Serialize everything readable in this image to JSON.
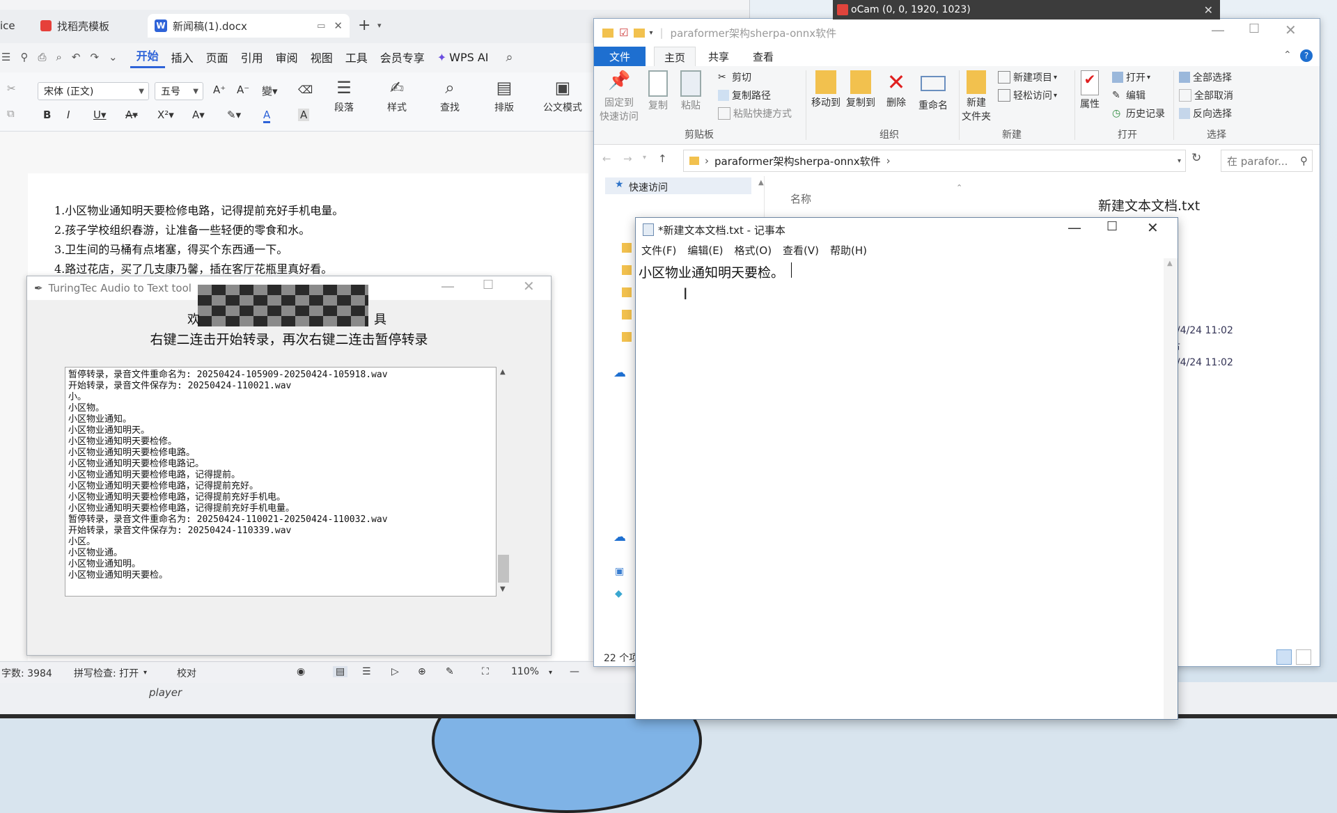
{
  "ocam": {
    "title": "oCam (0, 0, 1920, 1023)"
  },
  "desktop": {
    "player_label": "player"
  },
  "wps": {
    "tabs": [
      {
        "label": "ice"
      },
      {
        "label": "找稻壳模板"
      },
      {
        "label": "新闻稿(1).docx"
      }
    ],
    "menu": [
      "开始",
      "插入",
      "页面",
      "引用",
      "审阅",
      "视图",
      "工具",
      "会员专享"
    ],
    "wps_ai": "WPS AI",
    "font_name": "宋体 (正文)",
    "font_size": "五号",
    "ribbon_big": [
      "段落",
      "样式",
      "查找",
      "排版",
      "公文模式"
    ],
    "doc_lines": [
      "1.小区物业通知明天要检修电路，记得提前充好手机电量。",
      "2.孩子学校组织春游，让准备一些轻便的零食和水。",
      "3.卫生间的马桶有点堵塞，得买个东西通一下。",
      "4.路过花店，买了几支康乃馨，插在客厅花瓶里真好看。"
    ],
    "status": {
      "word_count": "字数: 3984",
      "spell_check": "拼写检查: 打开",
      "proofread": "校对",
      "zoom": "110%"
    }
  },
  "turingtec": {
    "title": "TuringTec Audio to Text tool",
    "line1": "欢",
    "line1_end": "具",
    "line2": "右键二连击开始转录，再次右键二连击暂停转录",
    "log": [
      "暂停转录，录音文件重命名为: 20250424-105909-20250424-105918.wav",
      "开始转录，录音文件保存为: 20250424-110021.wav",
      "小。",
      "小区物。",
      "小区物业通知。",
      "小区物业通知明天。",
      "小区物业通知明天要检修。",
      "小区物业通知明天要检修电路。",
      "小区物业通知明天要检修电路记。",
      "小区物业通知明天要检修电路，记得提前。",
      "小区物业通知明天要检修电路，记得提前充好。",
      "小区物业通知明天要检修电路，记得提前充好手机电。",
      "小区物业通知明天要检修电路，记得提前充好手机电量。",
      "暂停转录，录音文件重命名为: 20250424-110021-20250424-110032.wav",
      "开始转录，录音文件保存为: 20250424-110339.wav",
      "小区。",
      "小区物业通。",
      "小区物业通知明。",
      "小区物业通知明天要检。"
    ]
  },
  "explorer": {
    "title": "paraformer架构sherpa-onnx软件",
    "tabs": [
      "文件",
      "主页",
      "共享",
      "查看"
    ],
    "pin": "固定到\n快速访问",
    "pin_a": "固定到",
    "pin_b": "快速访问",
    "copy": "复制",
    "paste": "粘贴",
    "cut": "剪切",
    "copy_path": "复制路径",
    "paste_shortcut": "粘贴快捷方式",
    "group_clipboard": "剪贴板",
    "move_to": "移动到",
    "copy_to": "复制到",
    "delete": "删除",
    "rename": "重命名",
    "group_organize": "组织",
    "new_folder_a": "新建",
    "new_folder_b": "文件夹",
    "new_item": "新建项目",
    "easy_access": "轻松访问",
    "group_new": "新建",
    "properties": "属性",
    "open": "打开",
    "edit": "编辑",
    "history": "历史记录",
    "group_open": "打开",
    "select_all": "全部选择",
    "select_none": "全部取消",
    "invert_select": "反向选择",
    "group_select": "选择",
    "address": "paraformer架构sherpa-onnx软件",
    "search_placeholder": "在 parafor...",
    "quick_access": "快速访问",
    "col_name": "名称",
    "preview_file": "新建文本文档.txt",
    "date1": "5/4/24 11:02",
    "date_mid": "节",
    "date2": "5/4/24 11:02",
    "item_count": "22 个项"
  },
  "notepad": {
    "title": "*新建文本文档.txt - 记事本",
    "menu": [
      "文件(F)",
      "编辑(E)",
      "格式(O)",
      "查看(V)",
      "帮助(H)"
    ],
    "content": "小区物业通知明天要检。"
  },
  "colors": {
    "wps_accent": "#2e63d8",
    "explorer_file_tab": "#1e6fd0",
    "delete_red": "#e02020"
  }
}
